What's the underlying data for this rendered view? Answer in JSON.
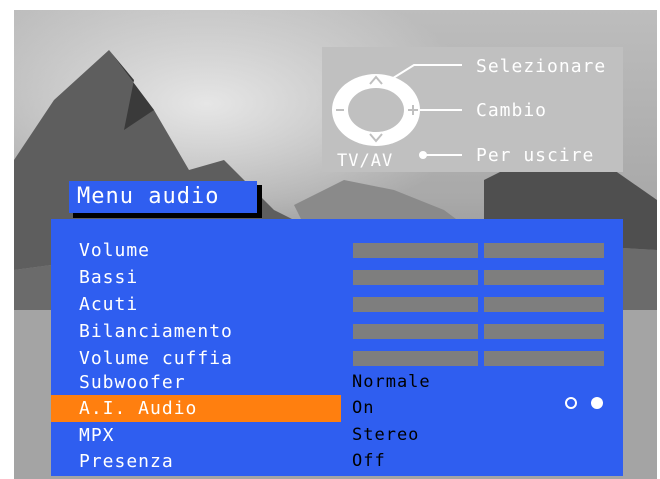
{
  "legend": {
    "select_label": "Selezionare",
    "change_label": "Cambio",
    "exit_label": "Per uscire",
    "exit_button_label": "TV/AV",
    "up_glyph": "^",
    "down_glyph": "v",
    "minus_glyph": "–",
    "plus_glyph": "+"
  },
  "menu": {
    "title": "Menu audio",
    "items": [
      {
        "label": "Volume",
        "control": "bar"
      },
      {
        "label": "Bassi",
        "control": "bar"
      },
      {
        "label": "Acuti",
        "control": "bar"
      },
      {
        "label": "Bilanciamento",
        "control": "bar"
      },
      {
        "label": "Volume cuffia",
        "control": "bar"
      },
      {
        "label": "Subwoofer",
        "value": "Normale"
      },
      {
        "label": "A.I. Audio",
        "value": "On",
        "selected": true
      },
      {
        "label": "MPX",
        "value": "Stereo"
      },
      {
        "label": "Presenza",
        "value": "Off"
      }
    ],
    "ai_audio_toggle": {
      "options": [
        "off",
        "on"
      ],
      "selected": "on"
    }
  },
  "colors": {
    "panel_blue": "#2f5ef0",
    "highlight_orange": "#ff7f0f",
    "bar_grey": "#7e7e7e",
    "legend_grey": "#c0c0c0"
  }
}
